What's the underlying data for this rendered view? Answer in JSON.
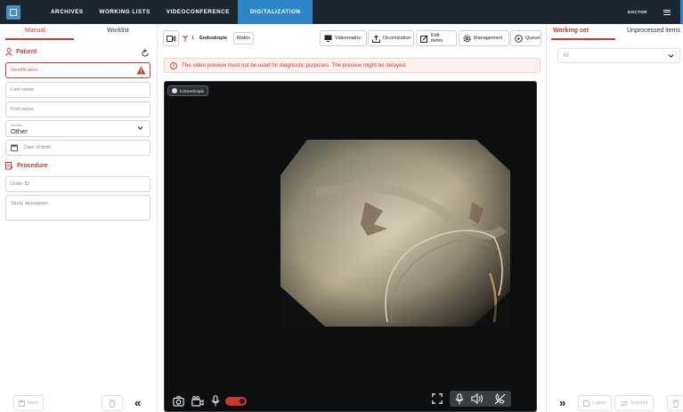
{
  "topbar": {
    "tabs": [
      {
        "label": "ARCHIVES"
      },
      {
        "label": "WORKING LISTS"
      },
      {
        "label": "VIDEOCONFERENCE"
      },
      {
        "label": "DIGITALIZATION",
        "active": true
      }
    ],
    "user": "DOCTOR",
    "icons": [
      "app-logo-icon",
      "hamburger-menu-icon"
    ],
    "accent_color": "#2e86c9",
    "bar_color": "#1c2630"
  },
  "left_panel": {
    "tabs": [
      {
        "label": "Manual",
        "active": true
      },
      {
        "label": "Worklist"
      }
    ],
    "patient_section": {
      "title": "Patient",
      "identification_placeholder": "Identification",
      "last_name_placeholder": "Last name",
      "first_name_placeholder": "First name",
      "gender_label": "Gender",
      "gender_value": "Other",
      "dob_placeholder": "Date of birth"
    },
    "procedure_section": {
      "title": "Procedure",
      "order_id_placeholder": "Order ID",
      "study_description_placeholder": "Study description"
    },
    "footer": {
      "save_label": "Save"
    }
  },
  "toolbar": {
    "source_count": "1",
    "source_label": "Endoskopie",
    "matrix_label": "Matrix",
    "buttons": [
      {
        "label": "Videomatrix",
        "icon": "monitor-icon"
      },
      {
        "label": "Dicomization",
        "icon": "upload-icon"
      },
      {
        "label": "Edit items",
        "icon": "edit-icon"
      },
      {
        "label": "Management",
        "icon": "gear-icon"
      },
      {
        "label": "Queue",
        "icon": "play-circle-icon"
      }
    ]
  },
  "alert": {
    "text": "The video preview must not be used for diagnostic purposes. The preview might be delayed.",
    "color": "#c8392e"
  },
  "video": {
    "source_chip": "Koloneskopie",
    "controls_left": [
      "camera-icon",
      "video-camera-icon",
      "microphone-icon",
      "record-toggle"
    ],
    "controls_right": [
      "fullscreen-icon",
      "microphone-icon",
      "speaker-icon",
      "hangup-icon"
    ]
  },
  "right_panel": {
    "tabs": [
      {
        "label": "Working set",
        "active": true
      },
      {
        "label": "Unprocessed items"
      }
    ],
    "filter_value": "All",
    "footer": {
      "labels_button": "Labels",
      "selected_button": "Selected"
    }
  }
}
